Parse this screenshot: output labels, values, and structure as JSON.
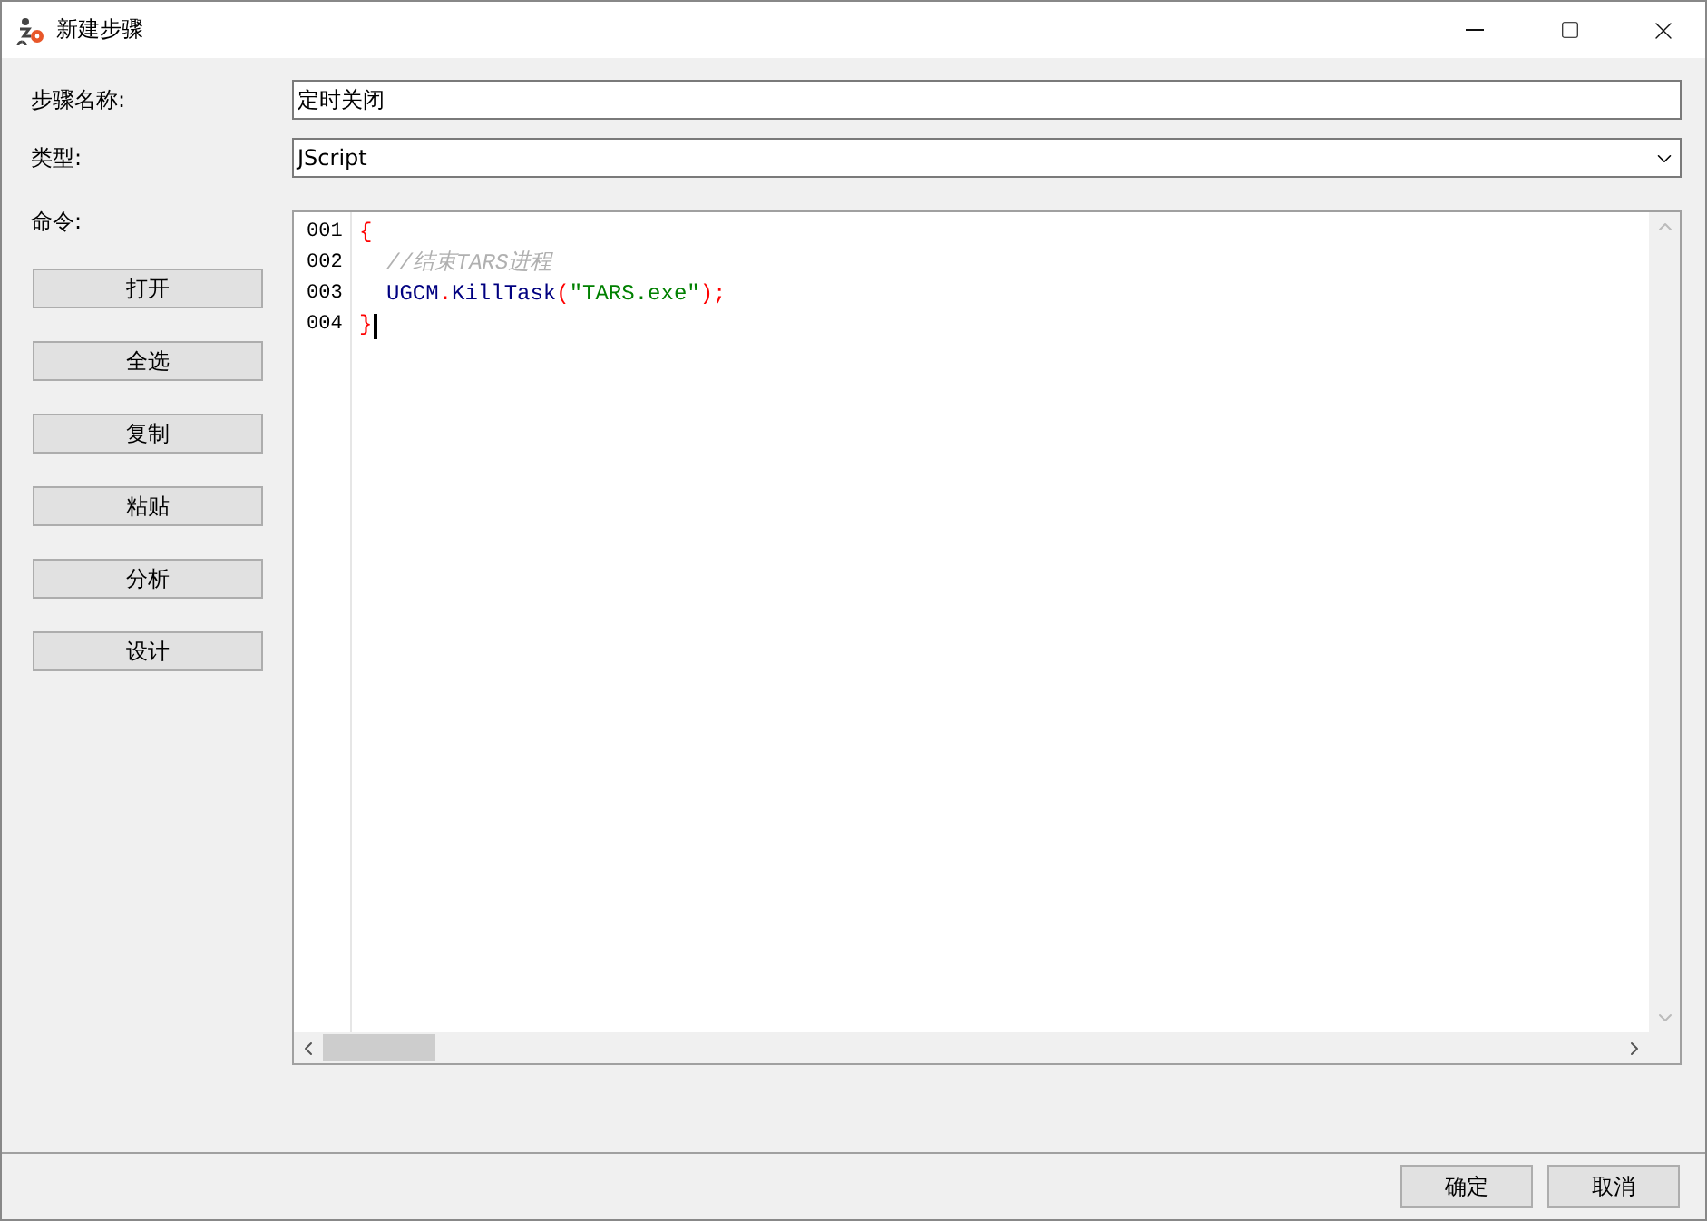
{
  "window": {
    "title": "新建步骤"
  },
  "form": {
    "name_label": "步骤名称:",
    "name_value": "定时关闭",
    "type_label": "类型:",
    "type_value": "JScript",
    "command_label": "命令:"
  },
  "side_buttons": [
    "打开",
    "全选",
    "复制",
    "粘贴",
    "分析",
    "设计"
  ],
  "editor": {
    "lines": [
      {
        "number": "001",
        "indented": false,
        "caret": false,
        "tokens": [
          {
            "kind": "brace",
            "text": "{"
          }
        ]
      },
      {
        "number": "002",
        "indented": true,
        "caret": false,
        "tokens": [
          {
            "kind": "comment",
            "text": "//结束TARS进程"
          }
        ]
      },
      {
        "number": "003",
        "indented": true,
        "caret": false,
        "tokens": [
          {
            "kind": "ident",
            "text": "UGCM"
          },
          {
            "kind": "punct",
            "text": "."
          },
          {
            "kind": "ident",
            "text": "KillTask"
          },
          {
            "kind": "punct",
            "text": "("
          },
          {
            "kind": "string",
            "text": "\"TARS.exe\""
          },
          {
            "kind": "punct",
            "text": ");"
          }
        ]
      },
      {
        "number": "004",
        "indented": false,
        "caret": true,
        "tokens": [
          {
            "kind": "brace",
            "text": "}"
          }
        ]
      }
    ]
  },
  "footer_buttons": [
    "确定",
    "取消"
  ]
}
